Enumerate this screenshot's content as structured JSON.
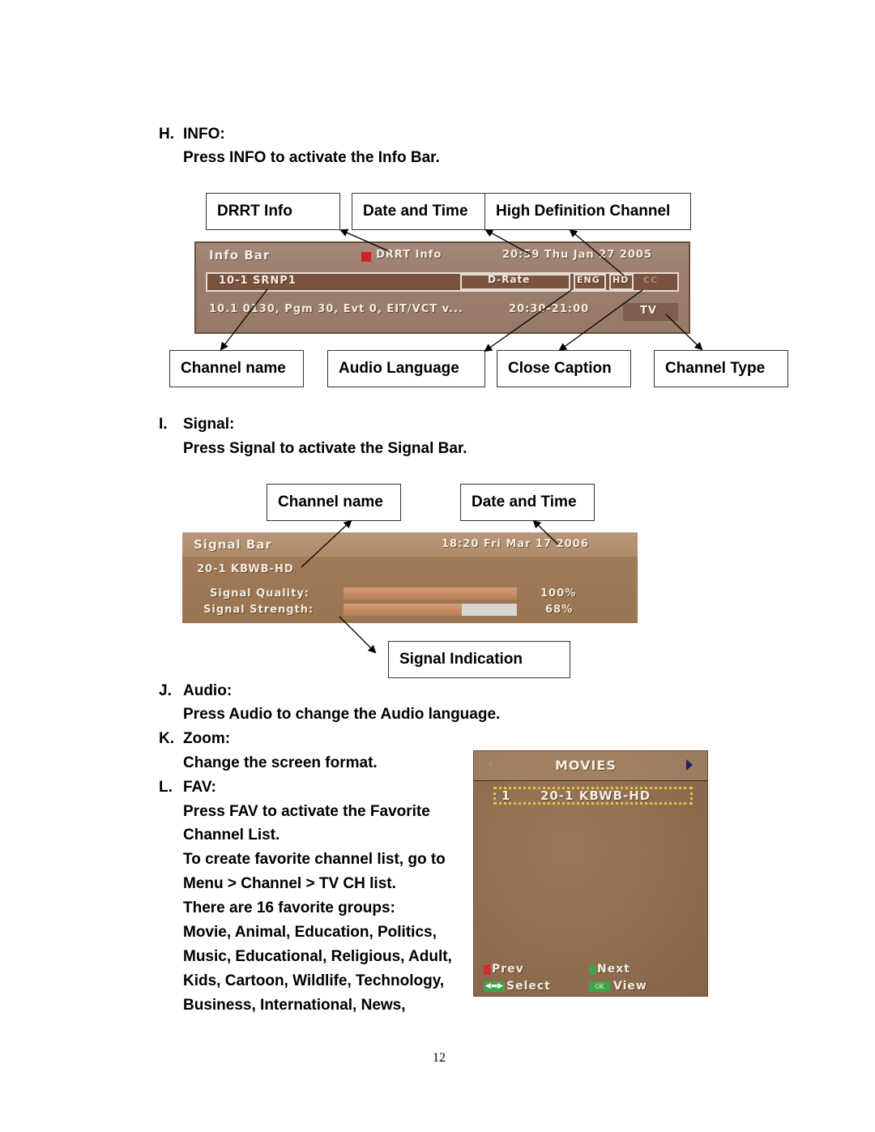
{
  "sections": {
    "info": {
      "heading_letter": "H.",
      "heading": "INFO:",
      "instruction": "Press INFO to activate the Info Bar.",
      "callouts_top": [
        "DRRT Info",
        "Date and Time",
        "High Definition Channel"
      ],
      "callouts_bottom": [
        "Channel name",
        "Audio Language",
        "Close Caption",
        "Channel Type"
      ],
      "info_bar": {
        "title": "Info Bar",
        "drrt_label": "DRRT Info",
        "datetime": "20:59 Thu Jan 27 2005",
        "channel": "10-1 SRNP1",
        "rating": "D-Rate",
        "audio": "ENG",
        "hd": "HD",
        "cc": "CC",
        "program_info": "10.1 0130, Pgm 30, Evt 0, EIT/VCT v...",
        "time_range": "20:30-21:00",
        "channel_type": "TV",
        "colors": {
          "background": "#9b7b67",
          "field": "#7a5240",
          "drrt_marker": "#d0202a"
        }
      }
    },
    "signal": {
      "heading_letter": "I.",
      "heading": "Signal:",
      "instruction": "Press Signal to activate the Signal Bar.",
      "callouts_top": [
        "Channel name",
        "Date and Time"
      ],
      "callout_bottom": "Signal Indication",
      "signal_bar": {
        "title": "Signal Bar",
        "datetime": "18:20 Fri Mar 17 2006",
        "channel": "20-1 KBWB-HD",
        "quality_label": "Signal Quality:",
        "quality_value": "100%",
        "quality_fraction": 1.0,
        "strength_label": "Signal Strength:",
        "strength_value": "68%",
        "strength_fraction": 0.68,
        "colors": {
          "background": "#a07a58",
          "bar_fill": "#c08a63",
          "bar_empty": "#d8d6d4"
        }
      }
    },
    "audio": {
      "heading_letter": "J.",
      "heading": "Audio:",
      "instruction": "Press Audio to change the Audio language."
    },
    "zoom": {
      "heading_letter": "K.",
      "heading": "Zoom:",
      "instruction": "Change the screen format."
    },
    "fav": {
      "heading_letter": "L.",
      "heading": "FAV:",
      "lines": [
        "Press FAV to activate the Favorite",
        "Channel List.",
        "To create favorite channel list, go to",
        "Menu > Channel > TV CH list.",
        "There are 16 favorite groups:",
        "Movie, Animal, Education, Politics,",
        "Music, Educational, Religious, Adult,",
        "Kids, Cartoon, Wildlife, Technology,",
        "Business, International, News,"
      ],
      "fav_panel": {
        "title": "MOVIES",
        "prev_arrow": "left-arrow-icon",
        "next_arrow": "right-arrow-icon",
        "entries": [
          {
            "index": "1",
            "channel": "20-1 KBWB-HD"
          }
        ],
        "footer": {
          "prev": "Prev",
          "next": "Next",
          "select": "Select",
          "view": "View",
          "ok_key": "OK"
        },
        "colors": {
          "background": "#8e6c4e",
          "highlight_border": "#e8c53a",
          "red_key": "#d42a2a",
          "green_key": "#3aa84a"
        }
      }
    }
  },
  "page_number": "12"
}
